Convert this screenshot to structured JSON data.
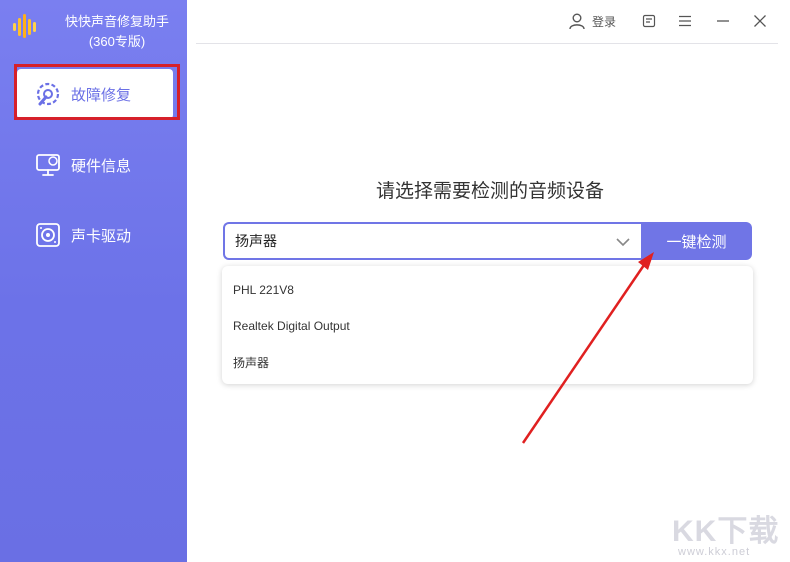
{
  "app": {
    "title_line1": "快快声音修复助手",
    "title_line2": "(360专版)"
  },
  "sidebar": {
    "items": [
      {
        "label": "故障修复",
        "icon": "repair-gear-icon",
        "active": true
      },
      {
        "label": "硬件信息",
        "icon": "monitor-icon",
        "active": false
      },
      {
        "label": "声卡驱动",
        "icon": "speaker-icon",
        "active": false
      }
    ]
  },
  "titlebar": {
    "login_label": "登录"
  },
  "main": {
    "heading": "请选择需要检测的音频设备",
    "select_value": "扬声器",
    "detect_button": "一键检测",
    "options": [
      "PHL 221V8",
      "Realtek Digital Output",
      "扬声器"
    ]
  },
  "watermark": {
    "main": "KK下载",
    "sub": "www.kkx.net"
  },
  "colors": {
    "accent": "#7075e6",
    "sidebar": "#6c72e8",
    "highlight": "#d6202a",
    "arrow": "#e02020"
  }
}
